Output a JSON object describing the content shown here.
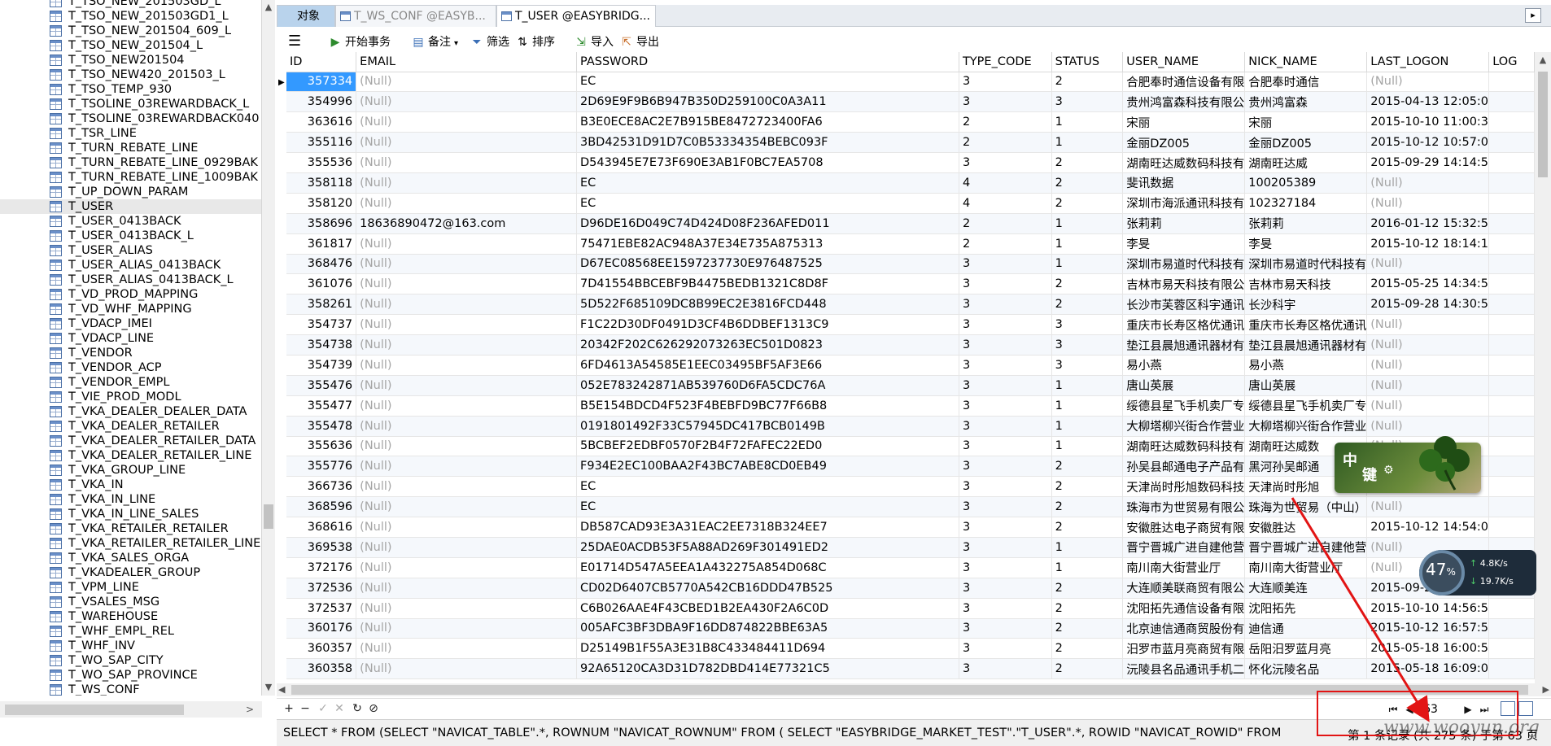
{
  "tree": {
    "items": [
      "T_TSO_NEW_201503GD_L",
      "T_TSO_NEW_201503GD1_L",
      "T_TSO_NEW_201504_609_L",
      "T_TSO_NEW_201504_L",
      "T_TSO_NEW201504",
      "T_TSO_NEW420_201503_L",
      "T_TSO_TEMP_930",
      "T_TSOLINE_03REWARDBACK_L",
      "T_TSOLINE_03REWARDBACK040",
      "T_TSR_LINE",
      "T_TURN_REBATE_LINE",
      "T_TURN_REBATE_LINE_0929BAK",
      "T_TURN_REBATE_LINE_1009BAK",
      "T_UP_DOWN_PARAM",
      "T_USER",
      "T_USER_0413BACK",
      "T_USER_0413BACK_L",
      "T_USER_ALIAS",
      "T_USER_ALIAS_0413BACK",
      "T_USER_ALIAS_0413BACK_L",
      "T_VD_PROD_MAPPING",
      "T_VD_WHF_MAPPING",
      "T_VDACP_IMEI",
      "T_VDACP_LINE",
      "T_VENDOR",
      "T_VENDOR_ACP",
      "T_VENDOR_EMPL",
      "T_VIE_PROD_MODL",
      "T_VKA_DEALER_DEALER_DATA",
      "T_VKA_DEALER_RETAILER",
      "T_VKA_DEALER_RETAILER_DATA",
      "T_VKA_DEALER_RETAILER_LINE",
      "T_VKA_GROUP_LINE",
      "T_VKA_IN",
      "T_VKA_IN_LINE",
      "T_VKA_IN_LINE_SALES",
      "T_VKA_RETAILER_RETAILER",
      "T_VKA_RETAILER_RETAILER_LINE",
      "T_VKA_SALES_ORGA",
      "T_VKADEALER_GROUP",
      "T_VPM_LINE",
      "T_VSALES_MSG",
      "T_WAREHOUSE",
      "T_WHF_EMPL_REL",
      "T_WHF_INV",
      "T_WO_SAP_CITY",
      "T_WO_SAP_PROVINCE",
      "T_WS_CONF"
    ],
    "selected": "T_USER"
  },
  "tabs": {
    "object": "对象",
    "ws_conf": "T_WS_CONF @EASYB...",
    "user": "T_USER @EASYBRIDG..."
  },
  "toolbar": {
    "begin_tx": "开始事务",
    "memo": "备注",
    "filter": "筛选",
    "sort": "排序",
    "import": "导入",
    "export": "导出"
  },
  "grid": {
    "columns": [
      "ID",
      "EMAIL",
      "PASSWORD",
      "TYPE_CODE",
      "STATUS",
      "USER_NAME",
      "NICK_NAME",
      "LAST_LOGON",
      "LOG"
    ],
    "rows": [
      [
        "357334",
        "(Null)",
        "EC",
        "3",
        "2",
        "合肥奉时通信设备有限",
        "合肥奉时通信",
        "(Null)"
      ],
      [
        "354996",
        "(Null)",
        "2D69E9F9B6B947B350D259100C0A3A11",
        "3",
        "3",
        "贵州鸿富森科技有限公",
        "贵州鸿富森",
        "2015-04-13 12:05:0"
      ],
      [
        "363616",
        "(Null)",
        "B3E0ECE8AC2E7B915BE8472723400FA6",
        "2",
        "1",
        "宋丽",
        "宋丽",
        "2015-10-10 11:00:3"
      ],
      [
        "355116",
        "(Null)",
        "3BD42531D91D7C0B53334354BEBC093F",
        "2",
        "1",
        "金丽DZ005",
        "金丽DZ005",
        "2015-10-12 10:57:0"
      ],
      [
        "355536",
        "(Null)",
        "D543945E7E73F690E3AB1F0BC7EA5708",
        "3",
        "2",
        "湖南旺达威数码科技有",
        "湖南旺达威",
        "2015-09-29 14:14:5"
      ],
      [
        "358118",
        "(Null)",
        "EC",
        "4",
        "2",
        "斐讯数据",
        "100205389",
        "(Null)"
      ],
      [
        "358120",
        "(Null)",
        "EC",
        "4",
        "2",
        "深圳市海派通讯科技有",
        "102327184",
        "(Null)"
      ],
      [
        "358696",
        "18636890472@163.com",
        "D96DE16D049C74D424D08F236AFED011",
        "2",
        "1",
        "张莉莉",
        "张莉莉",
        "2016-01-12 15:32:5"
      ],
      [
        "361817",
        "(Null)",
        "75471EBE82AC948A37E34E735A875313",
        "2",
        "1",
        "李旻",
        "李旻",
        "2015-10-12 18:14:1"
      ],
      [
        "368476",
        "(Null)",
        "D67EC08568EE1597237730E976487525",
        "3",
        "1",
        "深圳市易道时代科技有",
        "深圳市易道时代科技有",
        "(Null)"
      ],
      [
        "361076",
        "(Null)",
        "7D41554BBCEBF9B4475BEDB1321C8D8F",
        "3",
        "2",
        "吉林市易天科技有限公",
        "吉林市易天科技",
        "2015-05-25 14:34:5"
      ],
      [
        "358261",
        "(Null)",
        "5D522F685109DC8B99EC2E3816FCD448",
        "3",
        "2",
        "长沙市芙蓉区科宇通讯",
        "长沙科宇",
        "2015-09-28 14:30:5"
      ],
      [
        "354737",
        "(Null)",
        "F1C22D30DF0491D3CF4B6DDBEF1313C9",
        "3",
        "3",
        "重庆市长寿区格优通讯",
        "重庆市长寿区格优通讯",
        "(Null)"
      ],
      [
        "354738",
        "(Null)",
        "20342F202C626292073263EC501D0823",
        "3",
        "3",
        "垫江县晨旭通讯器材有",
        "垫江县晨旭通讯器材有",
        "(Null)"
      ],
      [
        "354739",
        "(Null)",
        "6FD4613A54585E1EEC03495BF5AF3E66",
        "3",
        "3",
        "易小燕",
        "易小燕",
        "(Null)"
      ],
      [
        "355476",
        "(Null)",
        "052E783242871AB539760D6FA5CDC76A",
        "3",
        "1",
        "唐山英展",
        "唐山英展",
        "(Null)"
      ],
      [
        "355477",
        "(Null)",
        "B5E154BDCD4F523F4BEBFD9BC77F66B8",
        "3",
        "1",
        "绥德县星飞手机卖厂专",
        "绥德县星飞手机卖厂专",
        "(Null)"
      ],
      [
        "355478",
        "(Null)",
        "0191801492F33C57945DC417BCB0149B",
        "3",
        "1",
        "大柳塔柳兴街合作营业",
        "大柳塔柳兴街合作营业",
        "(Null)"
      ],
      [
        "355636",
        "(Null)",
        "5BCBEF2EDBF0570F2B4F72FAFEC22ED0",
        "3",
        "1",
        "湖南旺达威数码科技有",
        "湖南旺达威数",
        "(Null)"
      ],
      [
        "355776",
        "(Null)",
        "F934E2EC100BAA2F43BC7ABE8CD0EB49",
        "3",
        "2",
        "孙吴县邮通电子产品有",
        "黑河孙吴邮通",
        "04:0"
      ],
      [
        "366736",
        "(Null)",
        "EC",
        "3",
        "2",
        "天津尚时彤旭数码科技",
        "天津尚时彤旭",
        "(Null)"
      ],
      [
        "368596",
        "(Null)",
        "EC",
        "3",
        "2",
        "珠海市为世贸易有限公",
        "珠海为世贸易（中山）",
        "(Null)"
      ],
      [
        "368616",
        "(Null)",
        "DB587CAD93E3A31EAC2EE7318B324EE7",
        "3",
        "2",
        "安徽胜达电子商贸有限",
        "安徽胜达",
        "2015-10-12 14:54:0"
      ],
      [
        "369538",
        "(Null)",
        "25DAE0ACDB53F5A88AD269F301491ED2",
        "3",
        "1",
        "晋宁晋城广进自建他营",
        "晋宁晋城广进自建他营",
        "(Null)"
      ],
      [
        "372176",
        "(Null)",
        "E01714D547A5EEA1A432275A854D068C",
        "3",
        "1",
        "南川南大街营业厅",
        "南川南大街营业厅",
        "(Null)"
      ],
      [
        "372536",
        "(Null)",
        "CD02D6407CB5770A542CB16DDD47B525",
        "3",
        "2",
        "大连顺美联商贸有限公",
        "大连顺美连",
        "2015-09-25"
      ],
      [
        "372537",
        "(Null)",
        "C6B026AAE4F43CBED1B2EA430F2A6C0D",
        "3",
        "2",
        "沈阳拓先通信设备有限",
        "沈阳拓先",
        "2015-10-10 14:56:5"
      ],
      [
        "360176",
        "(Null)",
        "005AFC3BF3DBA9F16DD874822BBE63A5",
        "3",
        "2",
        "北京迪信通商贸股份有",
        "迪信通",
        "2015-10-12 16:57:5"
      ],
      [
        "360357",
        "(Null)",
        "D25149B1F55A3E31B8C433484411D694",
        "3",
        "2",
        "汨罗市蓝月亮商贸有限",
        "岳阳汨罗蓝月亮",
        "2015-05-18 16:00:5"
      ],
      [
        "360358",
        "(Null)",
        "92A65120CA3D31D782DBD414E77321C5",
        "3",
        "2",
        "沅陵县名品通讯手机二",
        "怀化沅陵名品",
        "2015-05-18 16:09:0"
      ]
    ]
  },
  "pager": {
    "page": "63"
  },
  "status": {
    "sql": "SELECT * FROM (SELECT \"NAVICAT_TABLE\".*, ROWNUM \"NAVICAT_ROWNUM\" FROM ( SELECT \"EASYBRIDGE_MARKET_TEST\".\"T_USER\".*, ROWID \"NAVICAT_ROWID\" FROM",
    "records": "第 1 条记录 (共 275 条) 于第 63 页"
  },
  "overlays": {
    "ime_lang": "中",
    "ime_mode": "键",
    "net_percent": "47",
    "net_percent_sign": "%",
    "net_up": "4.8K/s",
    "net_down": "19.7K/s",
    "watermark": "www.wooyun.org"
  },
  "colors": {
    "selection": "#3399ff",
    "annotation": "#e21414",
    "null_text": "#a5a5a5"
  }
}
